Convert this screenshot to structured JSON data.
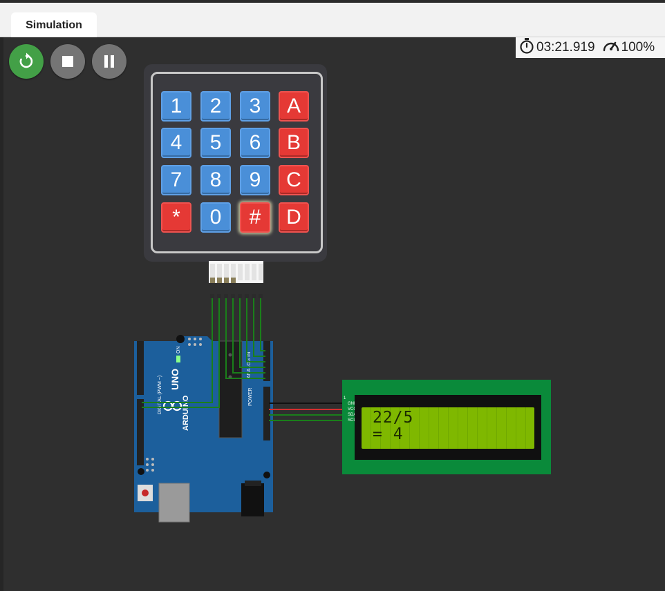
{
  "tabs": [
    {
      "label": "Simulation"
    }
  ],
  "controls": {
    "restart": {
      "icon": "restart-icon"
    },
    "stop": {
      "icon": "stop-icon"
    },
    "pause": {
      "icon": "pause-icon"
    }
  },
  "status": {
    "elapsed_time": "03:21.919",
    "speed": "100%"
  },
  "keypad": {
    "rows": [
      [
        "1",
        "2",
        "3",
        "A"
      ],
      [
        "4",
        "5",
        "6",
        "B"
      ],
      [
        "7",
        "8",
        "9",
        "C"
      ],
      [
        "*",
        "0",
        "#",
        "D"
      ]
    ],
    "pressed_key": "#"
  },
  "arduino": {
    "board_name": "UNO",
    "brand": "ARDUINO",
    "on_label": "ON",
    "digital_label": "DIGITAL (PWM ~)",
    "analog_label": "ANALOG IN",
    "power_label": "POWER"
  },
  "lcd": {
    "lines": [
      "22/5",
      "= 4"
    ],
    "pins": [
      "GND",
      "VCC",
      "SDA",
      "SCL"
    ],
    "pin_number": "1"
  },
  "colors": {
    "restart": "#43a047",
    "key_blue": "#4a8fd8",
    "key_red": "#e53935",
    "board": "#1c5f9c",
    "lcd_pcb": "#0a8a3a",
    "lcd_screen": "#7fb800"
  }
}
